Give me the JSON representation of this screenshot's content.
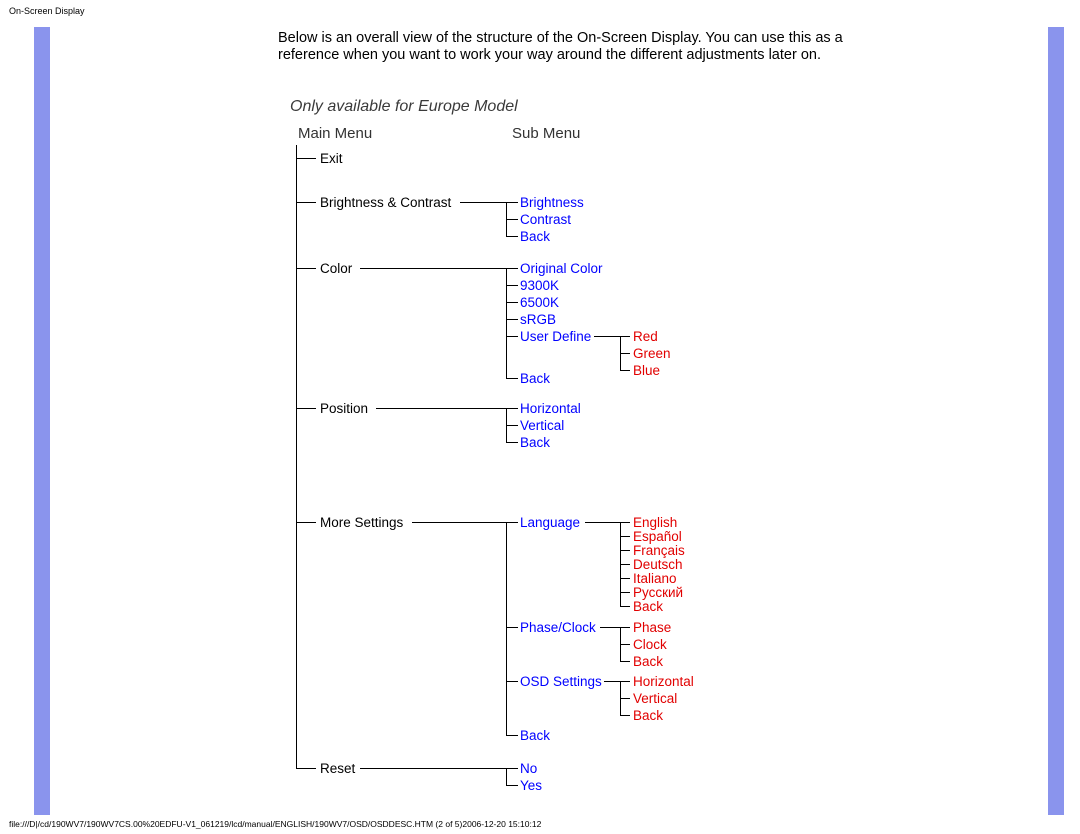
{
  "pageTitle": "On-Screen Display",
  "intro": "Below is an overall view of the structure of the On-Screen Display. You can use this as a reference when you want to work your way around the different adjustments later on.",
  "subtitle": "Only available for Europe Model",
  "headerMain": "Main Menu",
  "headerSub": "Sub Menu",
  "mainMenu": {
    "exit": "Exit",
    "brightnessContrast": "Brightness & Contrast",
    "color": "Color",
    "position": "Position",
    "moreSettings": "More Settings",
    "reset": "Reset"
  },
  "sub": {
    "brightness": "Brightness",
    "contrast": "Contrast",
    "back": "Back",
    "originalColor": "Original Color",
    "c9300": "9300K",
    "c6500": "6500K",
    "srgb": "sRGB",
    "userDefine": "User Define",
    "horizontal": "Horizontal",
    "vertical": "Vertical",
    "language": "Language",
    "phaseClock": "Phase/Clock",
    "osdSettings": "OSD Settings",
    "no": "No",
    "yes": "Yes"
  },
  "third": {
    "red": "Red",
    "green": "Green",
    "blue": "Blue",
    "english": "English",
    "espanol": "Español",
    "francais": "Français",
    "deutsch": "Deutsch",
    "italiano": "Italiano",
    "russian": "Русский",
    "back": "Back",
    "phase": "Phase",
    "clock": "Clock",
    "horizontal": "Horizontal",
    "vertical": "Vertical"
  },
  "footer": "file:///D|/cd/190WV7/190WV7CS.00%20EDFU-V1_061219/lcd/manual/ENGLISH/190WV7/OSD/OSDDESC.HTM (2 of 5)2006-12-20 15:10:12",
  "chart_data": {
    "type": "tree",
    "title": "OSD Menu Tree (Europe Model)",
    "columns": [
      "Main Menu",
      "Sub Menu",
      ""
    ],
    "tree": [
      {
        "label": "Exit"
      },
      {
        "label": "Brightness & Contrast",
        "children": [
          {
            "label": "Brightness"
          },
          {
            "label": "Contrast"
          },
          {
            "label": "Back"
          }
        ]
      },
      {
        "label": "Color",
        "children": [
          {
            "label": "Original Color"
          },
          {
            "label": "9300K"
          },
          {
            "label": "6500K"
          },
          {
            "label": "sRGB"
          },
          {
            "label": "User Define",
            "children": [
              {
                "label": "Red"
              },
              {
                "label": "Green"
              },
              {
                "label": "Blue"
              }
            ]
          },
          {
            "label": "Back"
          }
        ]
      },
      {
        "label": "Position",
        "children": [
          {
            "label": "Horizontal"
          },
          {
            "label": "Vertical"
          },
          {
            "label": "Back"
          }
        ]
      },
      {
        "label": "More Settings",
        "children": [
          {
            "label": "Language",
            "children": [
              {
                "label": "English"
              },
              {
                "label": "Español"
              },
              {
                "label": "Français"
              },
              {
                "label": "Deutsch"
              },
              {
                "label": "Italiano"
              },
              {
                "label": "Русский"
              },
              {
                "label": "Back"
              }
            ]
          },
          {
            "label": "Phase/Clock",
            "children": [
              {
                "label": "Phase"
              },
              {
                "label": "Clock"
              },
              {
                "label": "Back"
              }
            ]
          },
          {
            "label": "OSD Settings",
            "children": [
              {
                "label": "Horizontal"
              },
              {
                "label": "Vertical"
              },
              {
                "label": "Back"
              }
            ]
          },
          {
            "label": "Back"
          }
        ]
      },
      {
        "label": "Reset",
        "children": [
          {
            "label": "No"
          },
          {
            "label": "Yes"
          }
        ]
      }
    ]
  }
}
